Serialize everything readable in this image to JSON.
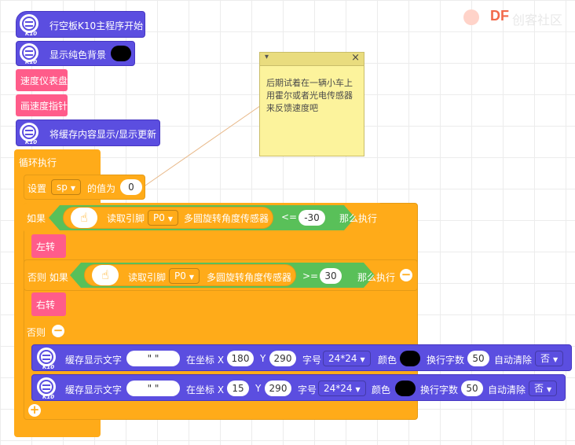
{
  "logo": {
    "brand": "DF",
    "sub": "创客社区"
  },
  "block_tag": "K10",
  "blocks": {
    "main_start": "行空板K10主程序开始",
    "show_bg": "显示纯色背景",
    "speedometer": "速度仪表盘",
    "draw_pointer": "画速度指针",
    "display_cache": "将缓存内容显示/显示更新",
    "loop": "循环执行",
    "set_var": {
      "label": "设置",
      "var": "sp",
      "mid": "的值为",
      "value": "0"
    },
    "if1": {
      "if": "如果",
      "read": "读取引脚",
      "pin": "P0",
      "sensor": "多圆旋转角度传感器",
      "op": "<=",
      "value": "-30",
      "then": "那么执行"
    },
    "turn_left": "左转",
    "elif": {
      "if": "否则 如果",
      "read": "读取引脚",
      "pin": "P0",
      "sensor": "多圆旋转角度传感器",
      "op": ">=",
      "value": "30",
      "then": "那么执行"
    },
    "turn_right": "右转",
    "else": "否则",
    "cache_text_1": {
      "label": "缓存显示文字",
      "text": "\"           \"",
      "at": "在坐标 X",
      "x": "180",
      "y_label": "Y",
      "y": "290",
      "font_label": "字号",
      "font": "24*24",
      "color_label": "颜色",
      "wrap_label": "换行字数",
      "wrap": "50",
      "clear_label": "自动清除",
      "clear": "否"
    },
    "cache_text_2": {
      "label": "缓存显示文字",
      "text": "\"           \"",
      "at": "在坐标 X",
      "x": "15",
      "y_label": "Y",
      "y": "290",
      "font_label": "字号",
      "font": "24*24",
      "color_label": "颜色",
      "wrap_label": "换行字数",
      "wrap": "50",
      "clear_label": "自动清除",
      "clear": "否"
    }
  },
  "note": {
    "text": "后期试着在一辆小车上用霍尔或者光电传感器来反馈速度吧",
    "toggle": "▾",
    "close": "×"
  },
  "icons": [
    "k10-logo-icon",
    "hand-touch-icon",
    "dropdown-arrow-icon",
    "minus-circle-icon",
    "plus-circle-icon",
    "close-icon"
  ],
  "colors": {
    "k10": "#5b4ee0",
    "pink": "#ff5c8a",
    "orange": "#ffab19",
    "green": "#59c059",
    "note": "#fcf39c"
  }
}
